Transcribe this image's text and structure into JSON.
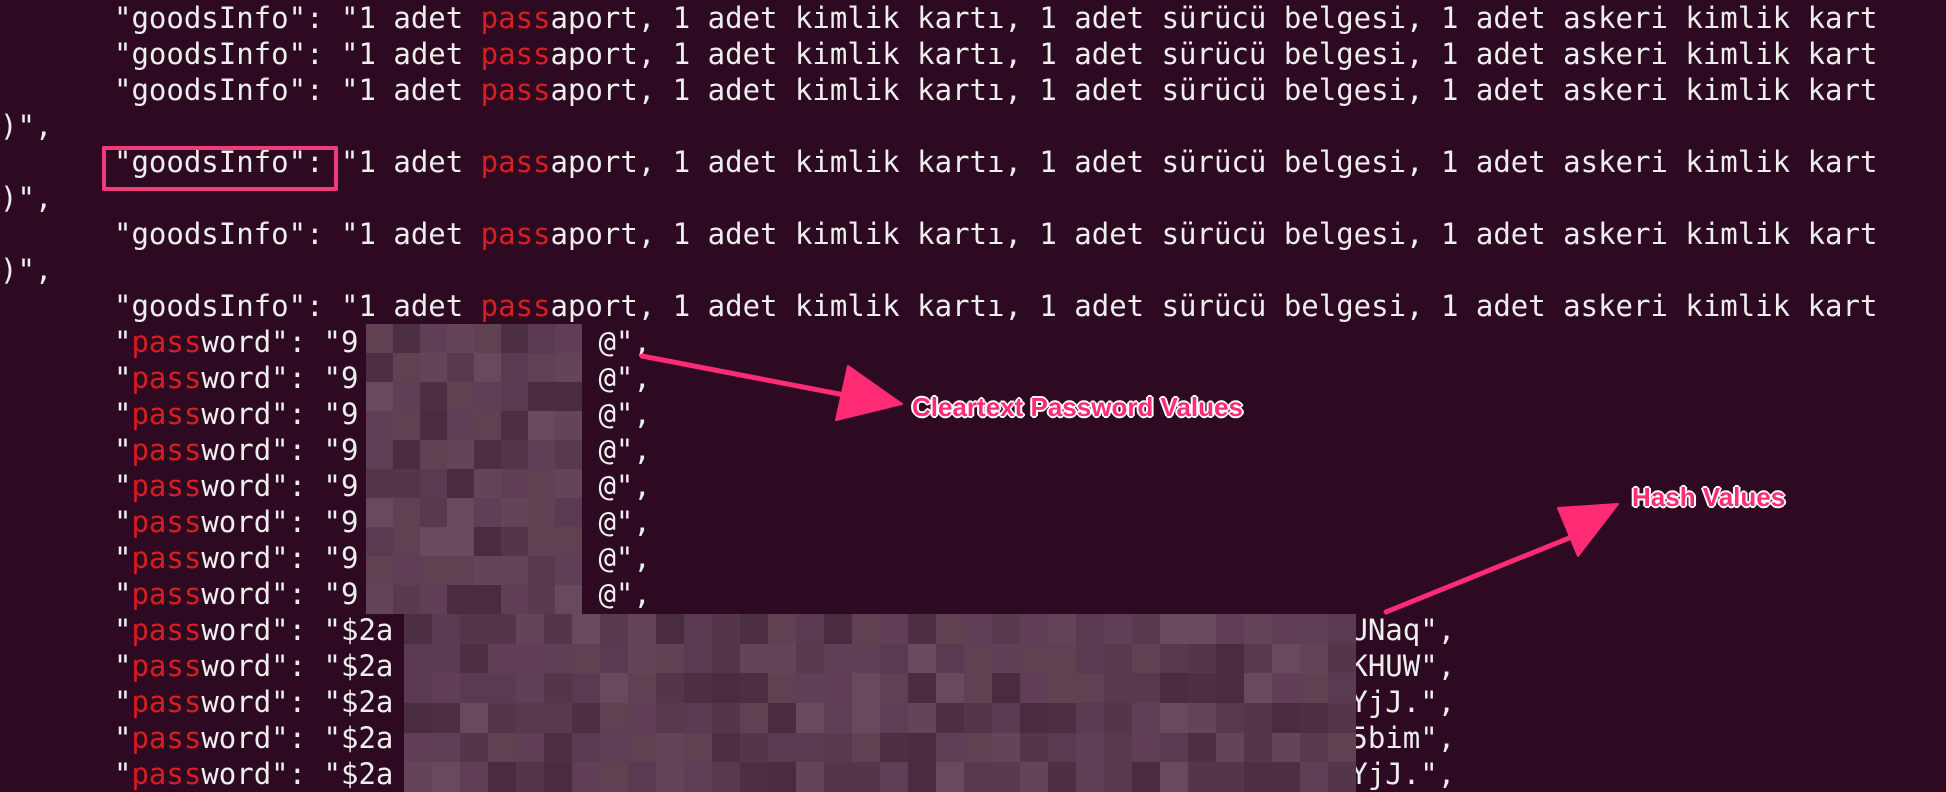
{
  "terminal": {
    "colors": {
      "background": "#2d0a22",
      "text": "#eeeeec",
      "search_highlight": "#d81e1e",
      "annotation": "#ff2b74"
    },
    "goods_lines": [
      {
        "key": "\"goodsInfo\"",
        "sep": ": \"1 adet ",
        "match": "pass",
        "rest": "aport, 1 adet kimlik kartı, 1 adet sürücü belgesi, 1 adet askeri kimlik kart"
      },
      {
        "key": "\"goodsInfo\"",
        "sep": ": \"1 adet ",
        "match": "pass",
        "rest": "aport, 1 adet kimlik kartı, 1 adet sürücü belgesi, 1 adet askeri kimlik kart"
      },
      {
        "key": "\"goodsInfo\"",
        "sep": ": \"1 adet ",
        "match": "pass",
        "rest": "aport, 1 adet kimlik kartı, 1 adet sürücü belgesi, 1 adet askeri kimlik kart"
      },
      {
        "key": "\"goodsInfo\"",
        "sep": ": \"1 adet ",
        "match": "pass",
        "rest": "aport, 1 adet kimlik kartı, 1 adet sürücü belgesi, 1 adet askeri kimlik kart"
      },
      {
        "key": "\"goodsInfo\"",
        "sep": ": \"1 adet ",
        "match": "pass",
        "rest": "aport, 1 adet kimlik kartı, 1 adet sürücü belgesi, 1 adet askeri kimlik kart"
      },
      {
        "key": "\"goodsInfo\"",
        "sep": ": \"1 adet ",
        "match": "pass",
        "rest": "aport, 1 adet kimlik kartı, 1 adet sürücü belgesi, 1 adet askeri kimlik kart"
      }
    ],
    "wrap_line": ")\",",
    "password_key_parts": {
      "quote": "\"",
      "match": "pass",
      "rest": "word\": \""
    },
    "cleartext_passwords": [
      {
        "prefix": "9",
        "suffix": "@\","
      },
      {
        "prefix": "9",
        "suffix": "@\","
      },
      {
        "prefix": "9",
        "suffix": "@\","
      },
      {
        "prefix": "9",
        "suffix": "@\","
      },
      {
        "prefix": "9",
        "suffix": "@\","
      },
      {
        "prefix": "9",
        "suffix": "@\","
      },
      {
        "prefix": "9",
        "suffix": "@\","
      },
      {
        "prefix": "9",
        "suffix": "@\","
      }
    ],
    "hash_passwords": [
      {
        "prefix": "$2a",
        "suffix": "UNaq\","
      },
      {
        "prefix": "$2a",
        "suffix": "KHUW\","
      },
      {
        "prefix": "$2a",
        "suffix": "YjJ.\","
      },
      {
        "prefix": "$2a",
        "suffix": "5bim\","
      },
      {
        "prefix": "$2a",
        "suffix": "YjJ.\","
      }
    ]
  },
  "annotations": {
    "cleartext_label": "Cleartext Password Values",
    "hash_label": "Hash Values"
  }
}
